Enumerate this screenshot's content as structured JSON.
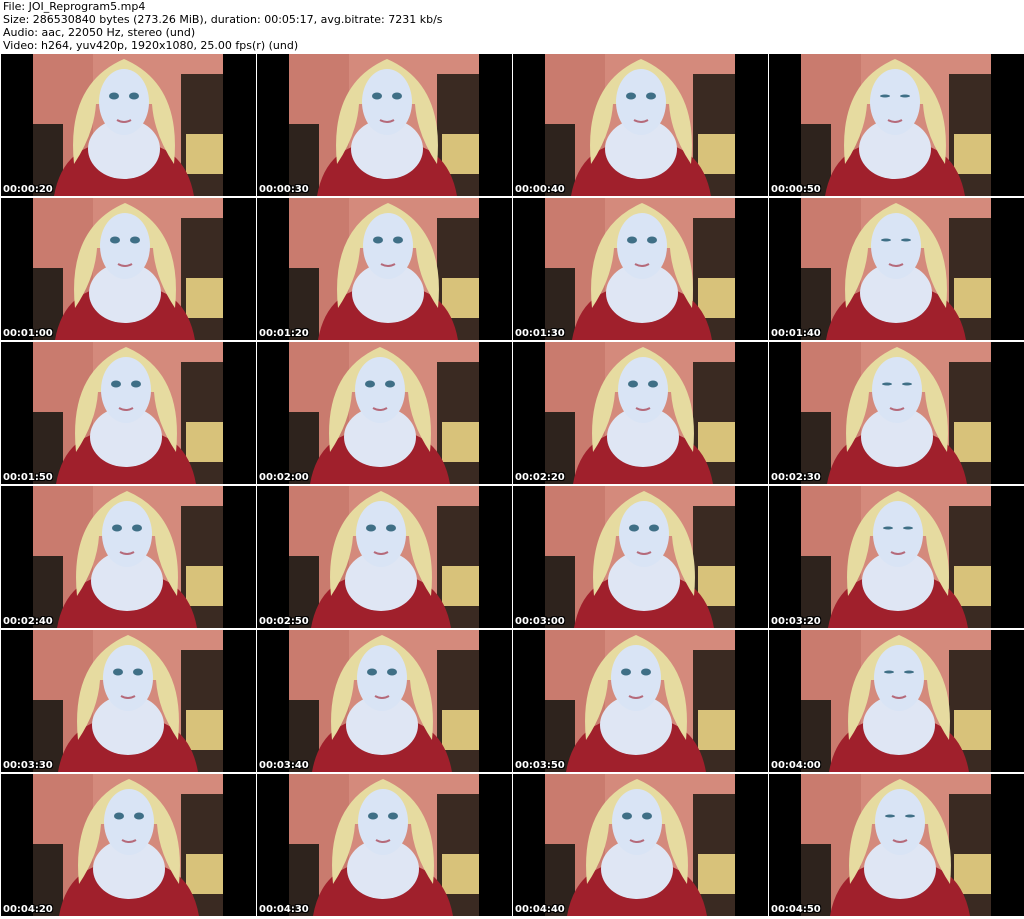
{
  "header": {
    "file": "File: JOI_Reprogram5.mp4",
    "size": "Size: 286530840 bytes (273.26 MiB), duration: 00:05:17, avg.bitrate: 7231 kb/s",
    "audio": "Audio: aac, 22050 Hz, stereo (und)",
    "video": "Video: h264, yuv420p, 1920x1080, 25.00 fps(r) (und)"
  },
  "frames": [
    {
      "timestamp": "00:00:20"
    },
    {
      "timestamp": "00:00:30"
    },
    {
      "timestamp": "00:00:40"
    },
    {
      "timestamp": "00:00:50"
    },
    {
      "timestamp": "00:01:00"
    },
    {
      "timestamp": "00:01:20"
    },
    {
      "timestamp": "00:01:30"
    },
    {
      "timestamp": "00:01:40"
    },
    {
      "timestamp": "00:01:50"
    },
    {
      "timestamp": "00:02:00"
    },
    {
      "timestamp": "00:02:20"
    },
    {
      "timestamp": "00:02:30"
    },
    {
      "timestamp": "00:02:40"
    },
    {
      "timestamp": "00:02:50"
    },
    {
      "timestamp": "00:03:00"
    },
    {
      "timestamp": "00:03:20"
    },
    {
      "timestamp": "00:03:30"
    },
    {
      "timestamp": "00:03:40"
    },
    {
      "timestamp": "00:03:50"
    },
    {
      "timestamp": "00:04:00"
    },
    {
      "timestamp": "00:04:20"
    },
    {
      "timestamp": "00:04:30"
    },
    {
      "timestamp": "00:04:40"
    },
    {
      "timestamp": "00:04:50"
    }
  ]
}
